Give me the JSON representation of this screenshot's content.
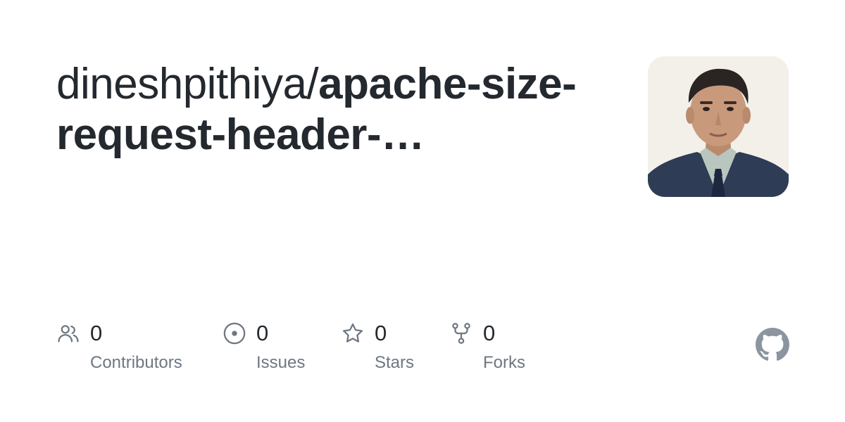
{
  "repo": {
    "owner": "dineshpithiya/",
    "name": "apache-size-request-header-…"
  },
  "avatar": {
    "alt": "owner avatar photo"
  },
  "stats": [
    {
      "icon": "people-icon",
      "count": "0",
      "label": "Contributors"
    },
    {
      "icon": "issue-icon",
      "count": "0",
      "label": "Issues"
    },
    {
      "icon": "star-icon",
      "count": "0",
      "label": "Stars"
    },
    {
      "icon": "fork-icon",
      "count": "0",
      "label": "Forks"
    }
  ],
  "colors": {
    "text": "#24292f",
    "muted": "#6e7781",
    "icon": "#6e7781",
    "logo": "#8c959f"
  },
  "brand_icon": "github-logo-icon"
}
